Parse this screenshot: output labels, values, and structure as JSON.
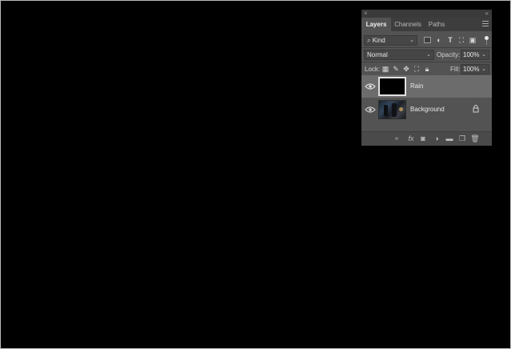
{
  "panel": {
    "close_glyph": "×",
    "collapse_glyph": "«",
    "tabs": [
      {
        "label": "Layers",
        "active": true
      },
      {
        "label": "Channels",
        "active": false
      },
      {
        "label": "Paths",
        "active": false
      }
    ],
    "filter": {
      "kind_label": "Kind",
      "icons": [
        "image-filter-icon",
        "adjustment-filter-icon",
        "type-filter-icon",
        "shape-filter-icon",
        "smart-object-filter-icon"
      ],
      "type_glyph": "T"
    },
    "blend": {
      "mode": "Normal",
      "opacity_label": "Opacity:",
      "opacity_value": "100%"
    },
    "lock": {
      "label": "Lock:",
      "fill_label": "Fill:",
      "fill_value": "100%"
    },
    "layers": [
      {
        "name": "Rain",
        "selected": true,
        "visible": true,
        "locked": false
      },
      {
        "name": "Background",
        "selected": false,
        "visible": true,
        "locked": true
      }
    ],
    "footer_icons": [
      "link-layers-icon",
      "fx-icon",
      "mask-icon",
      "adjustment-layer-icon",
      "group-icon",
      "new-layer-icon",
      "delete-layer-icon"
    ],
    "fx_label": "fx"
  },
  "colors": {
    "canvas": "#000000",
    "panel_bg": "#535353",
    "selected_layer": "#6c6c6c"
  }
}
